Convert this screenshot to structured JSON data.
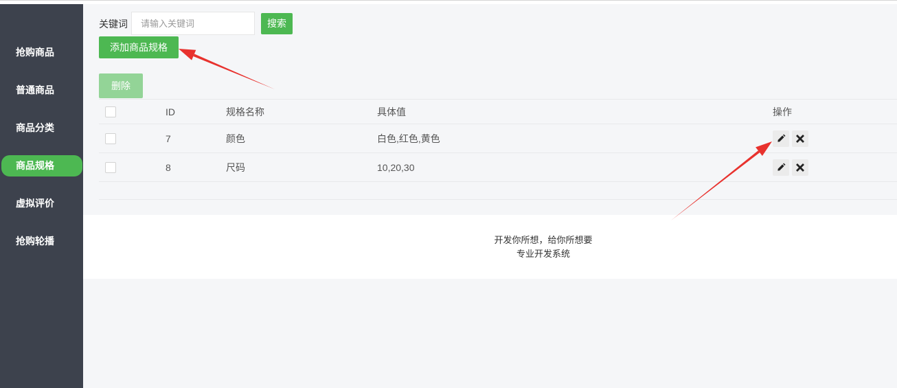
{
  "sidebar": {
    "items": [
      {
        "label": "抢购商品",
        "active": false
      },
      {
        "label": "普通商品",
        "active": false
      },
      {
        "label": "商品分类",
        "active": false
      },
      {
        "label": "商品规格",
        "active": true
      },
      {
        "label": "虚拟评价",
        "active": false
      },
      {
        "label": "抢购轮播",
        "active": false
      }
    ]
  },
  "search": {
    "label": "关键词",
    "placeholder": "请输入关键词",
    "value": "",
    "button_label": "搜索"
  },
  "toolbar": {
    "add_label": "添加商品规格",
    "delete_label": "删除"
  },
  "table": {
    "columns": [
      "ID",
      "规格名称",
      "具体值",
      "操作"
    ],
    "rows": [
      {
        "id": "7",
        "name": "颜色",
        "values": "白色,红色,黄色"
      },
      {
        "id": "8",
        "name": "尺码",
        "values": "10,20,30"
      }
    ]
  },
  "footer": {
    "line1": "开发你所想，给你所想要",
    "line2": "专业开发系统"
  },
  "icons": {
    "edit": "pencil-icon",
    "delete": "close-icon"
  },
  "colors": {
    "sidebar_bg": "#3d424d",
    "accent": "#4db852",
    "accent_disabled": "#93d497",
    "page_bg": "#f5f6f8",
    "annotation": "#e8322e"
  }
}
